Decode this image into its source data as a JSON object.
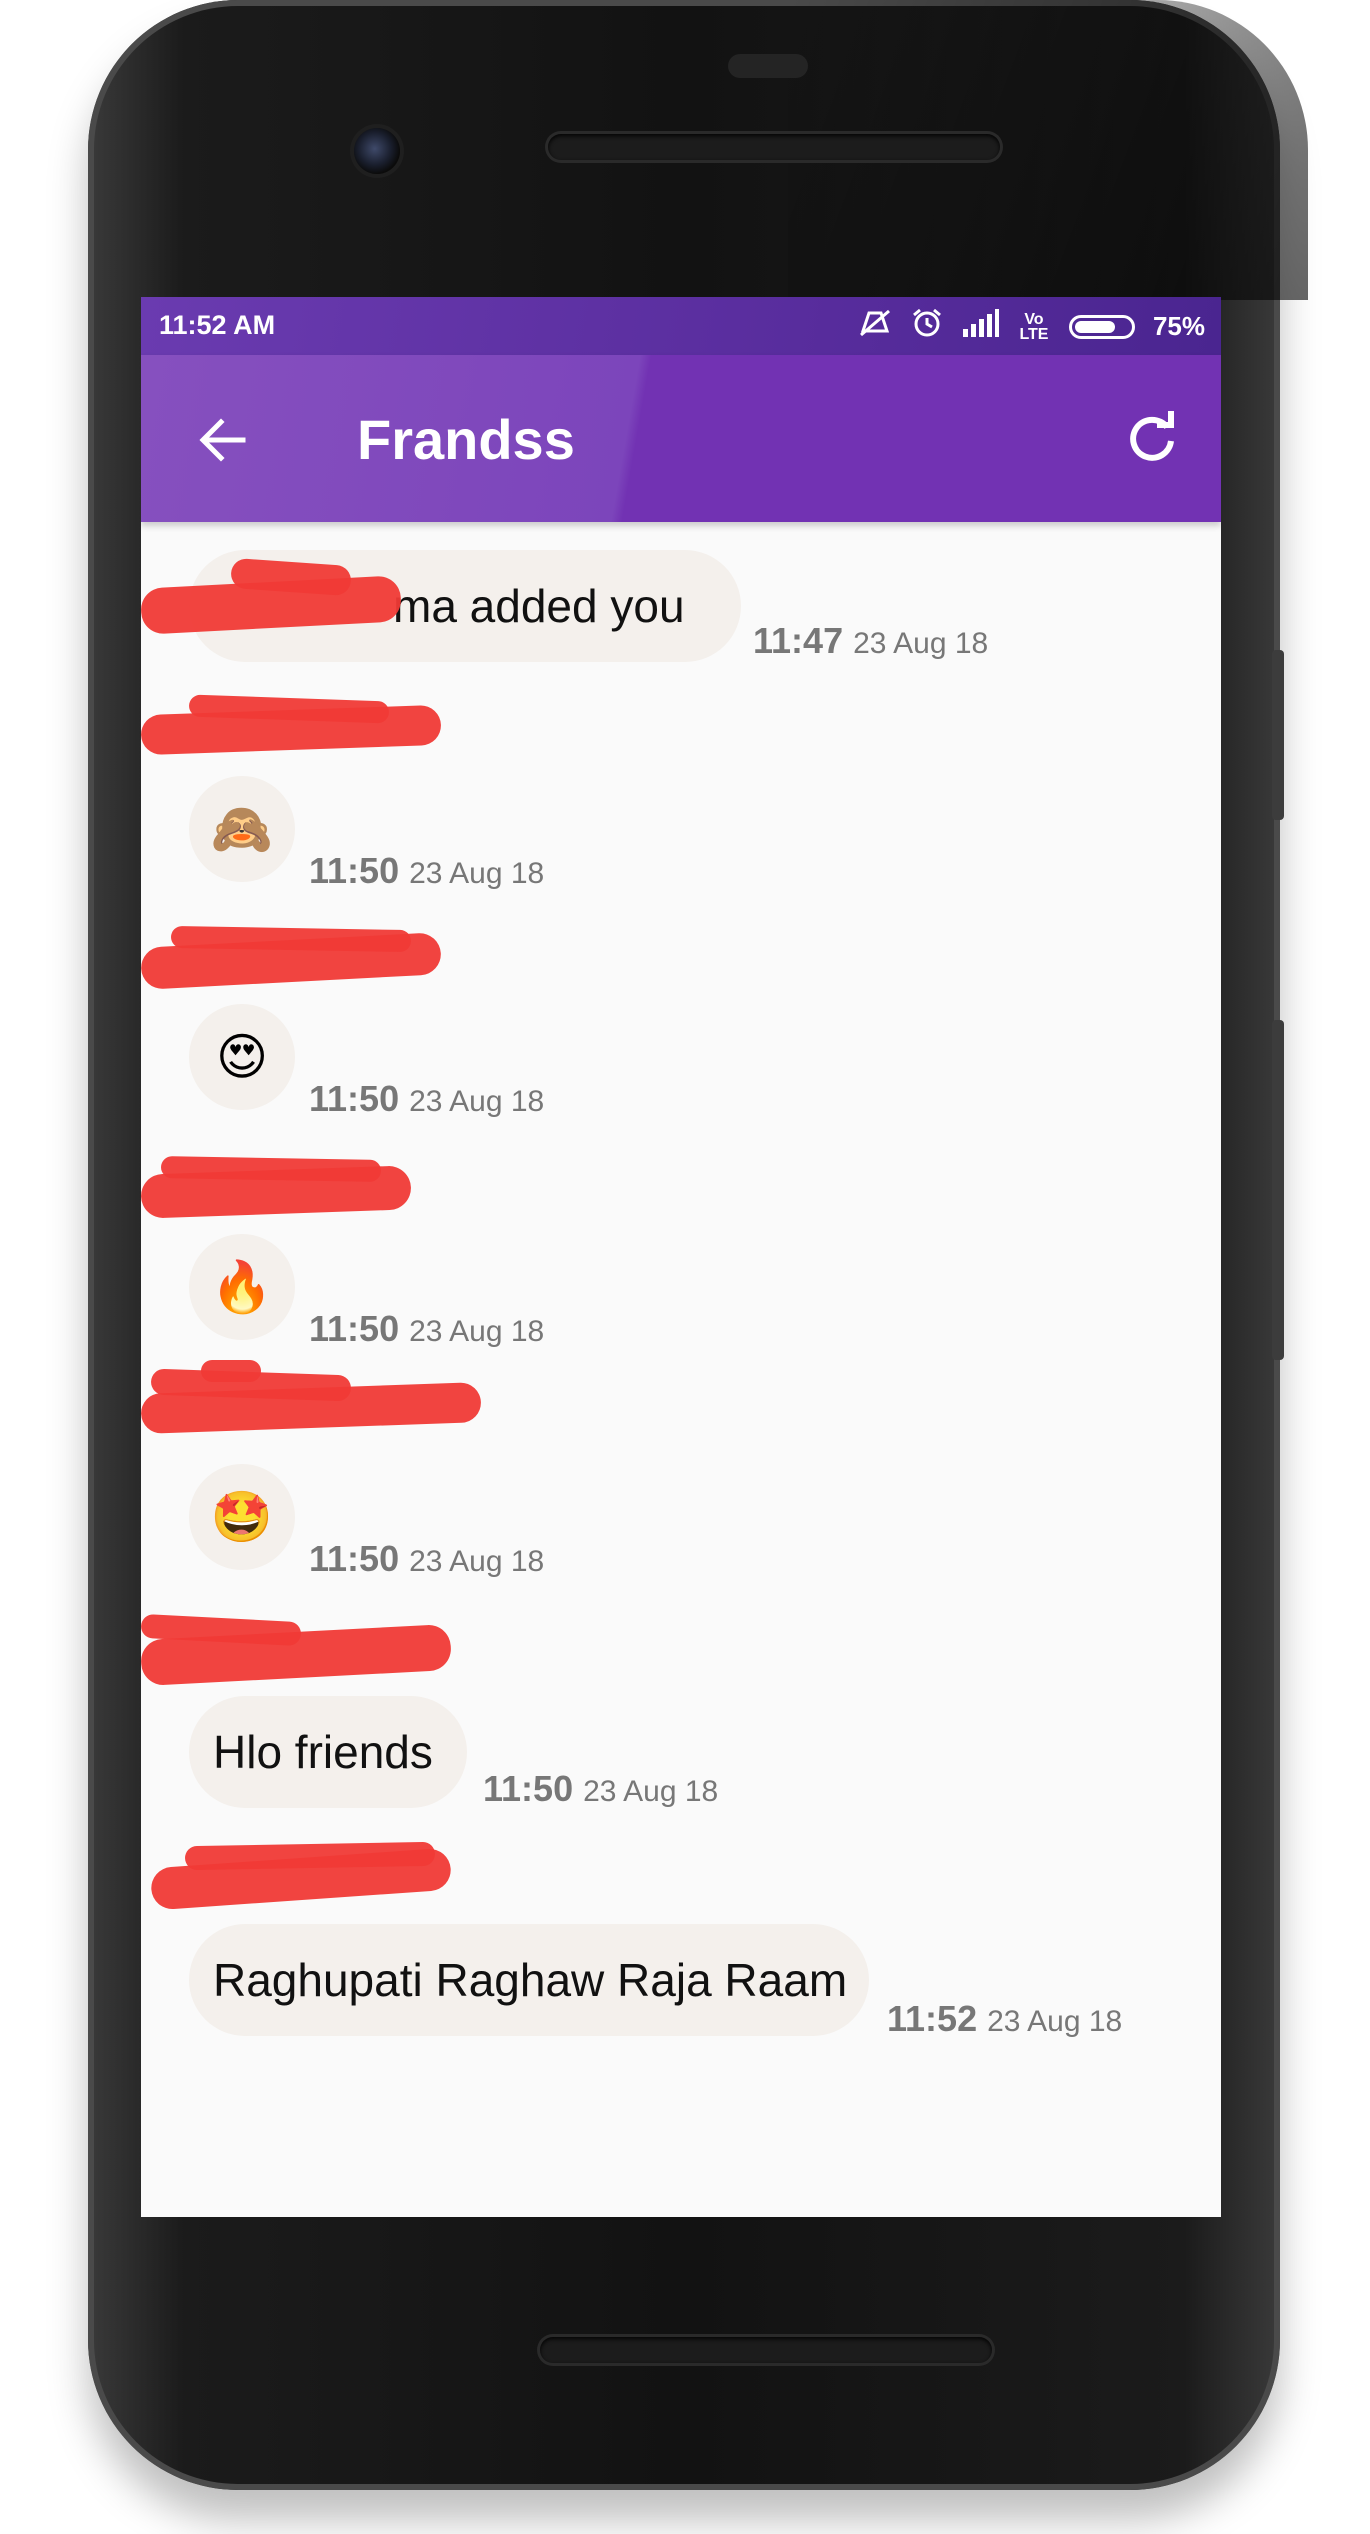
{
  "status_bar": {
    "time": "11:52 AM",
    "icons": [
      "muted-vibrate-icon",
      "alarm-icon",
      "signal-icon",
      "volte-icon",
      "battery-icon"
    ],
    "volte_label": "Vo LTE",
    "battery_percent": "75%",
    "battery_level": 0.75
  },
  "app_bar": {
    "title": "Frandss",
    "back_icon": "arrow-left-icon",
    "refresh_icon": "refresh-icon"
  },
  "messages": [
    {
      "kind": "system",
      "text": "ma added you",
      "time": "11:47",
      "date": "23 Aug 18"
    },
    {
      "kind": "emoji",
      "sender": "",
      "text": "🙈",
      "time": "11:50",
      "date": "23 Aug 18"
    },
    {
      "kind": "emoji",
      "sender": "",
      "text": "😍",
      "time": "11:50",
      "date": "23 Aug 18"
    },
    {
      "kind": "emoji",
      "sender": "",
      "text": "🔥",
      "time": "11:50",
      "date": "23 Aug 18"
    },
    {
      "kind": "emoji",
      "sender": "",
      "text": "🤩",
      "time": "11:50",
      "date": "23 Aug 18"
    },
    {
      "kind": "text",
      "sender": "",
      "text": "Hlo friends",
      "time": "11:50",
      "date": "23 Aug 18"
    },
    {
      "kind": "text",
      "sender": "",
      "text": "Raghupati Raghaw Raja Raam",
      "time": "11:52",
      "date": "23 Aug 18"
    }
  ],
  "colors": {
    "status_bar": "#5a2e9f",
    "app_bar": "#7232b3",
    "bubble": "#f4f0ec",
    "background": "#fafafa",
    "redaction": "#f03a36"
  }
}
